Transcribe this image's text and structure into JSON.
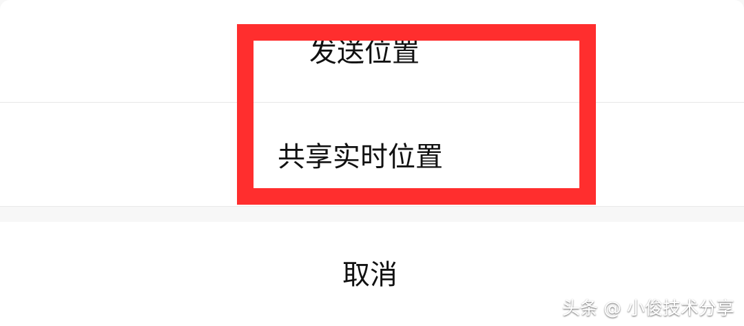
{
  "options": {
    "send_location": "发送位置",
    "share_realtime_location": "共享实时位置"
  },
  "cancel": {
    "label": "取消"
  },
  "watermark": {
    "source": "头条",
    "at_symbol": "@",
    "author": "小俊技术分享"
  },
  "colors": {
    "highlight": "#ff2e2e",
    "background": "#f7f7f7",
    "surface": "#ffffff",
    "divider": "#e6e6e6",
    "text": "#111111"
  }
}
